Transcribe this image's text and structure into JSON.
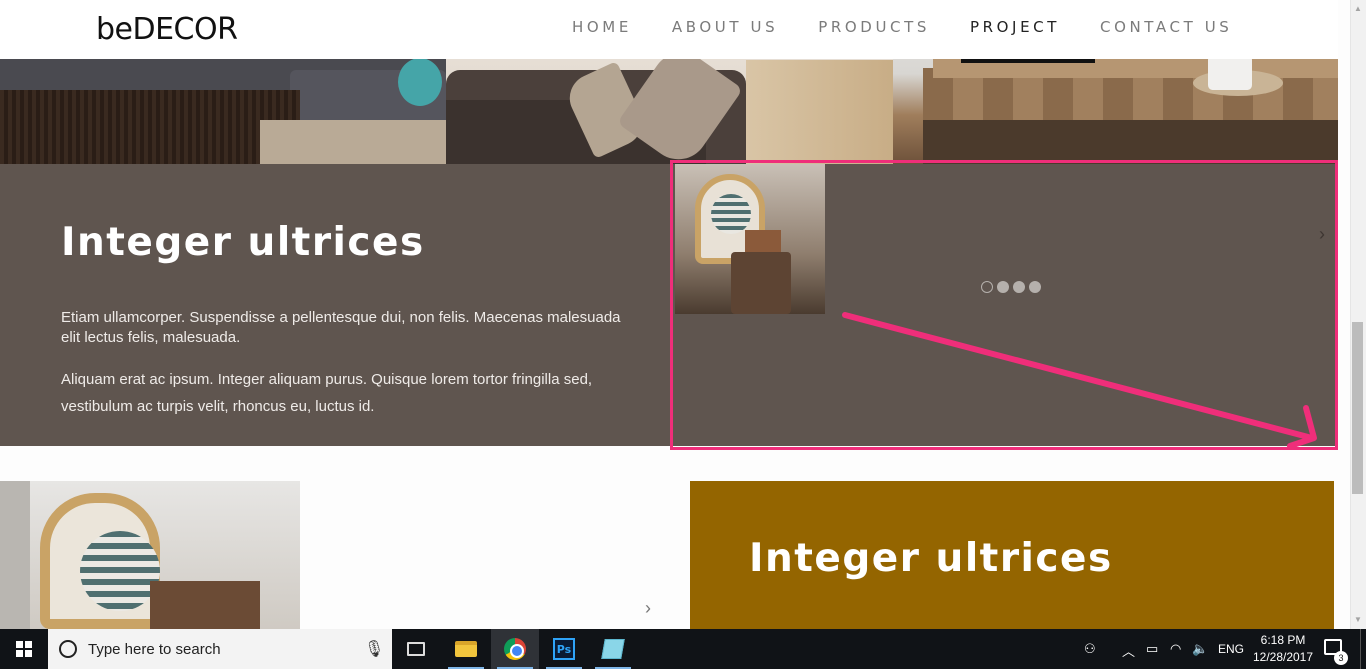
{
  "header": {
    "logo": "beDECOR",
    "nav": [
      "HOME",
      "ABOUT US",
      "PRODUCTS",
      "PROJECT",
      "CONTACT US"
    ],
    "active_nav": "PROJECT"
  },
  "section1": {
    "title": "Integer ultrices",
    "paragraph1": "Etiam ullamcorper. Suspendisse a pellentesque dui, non felis. Maecenas malesuada elit lectus felis, malesuada.",
    "paragraph2": "Aliquam erat ac ipsum. Integer aliquam purus. Quisque lorem tortor fringilla sed, vestibulum ac turpis velit, rhoncus eu, luctus id.",
    "carousel_dots": 4,
    "carousel_active_dot": 1,
    "next_glyph": "›"
  },
  "section2": {
    "title": "Integer ultrices",
    "next_glyph": "›"
  },
  "colors": {
    "brown_panel": "#5f554f",
    "gold_panel": "#946500",
    "annotation": "#ef2e7a"
  },
  "taskbar": {
    "search_placeholder": "Type here to search",
    "ps_label": "Ps",
    "lang": "ENG",
    "time": "6:18 PM",
    "date": "12/28/2017",
    "notification_count": "3"
  }
}
